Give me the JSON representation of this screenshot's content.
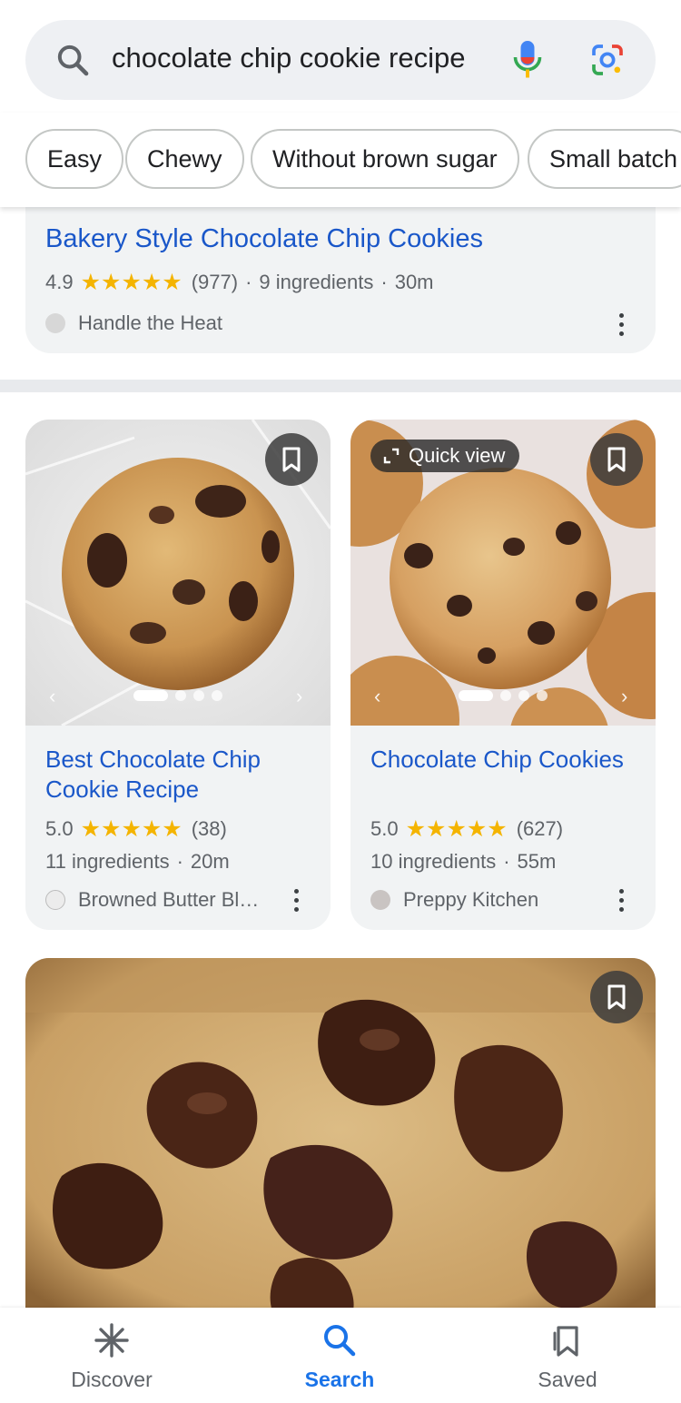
{
  "search": {
    "query": "chocolate chip cookie recipe",
    "icons": [
      "search-icon",
      "mic-icon",
      "lens-icon"
    ]
  },
  "chips": [
    "Easy",
    "Chewy",
    "Without brown sugar",
    "Small batch"
  ],
  "top_result": {
    "title": "Bakery Style Chocolate Chip Cookies",
    "rating": "4.9",
    "reviews": "(977)",
    "ingredients": "9 ingredients",
    "time": "30m",
    "source": "Handle the Heat"
  },
  "recipes": [
    {
      "title": "Best Chocolate Chip Cookie Recipe",
      "rating": "5.0",
      "reviews": "(38)",
      "ingredients": "11 ingredients",
      "time": "20m",
      "source": "Browned Butter Bl…",
      "image_slides": 4,
      "active_slide": 1
    },
    {
      "title": "Chocolate Chip Cookies",
      "rating": "5.0",
      "reviews": "(627)",
      "ingredients": "10 ingredients",
      "time": "55m",
      "source": "Preppy Kitchen",
      "quick_view_label": "Quick view",
      "image_slides": 4,
      "active_slide": 1
    }
  ],
  "nav": {
    "discover": "Discover",
    "search": "Search",
    "saved": "Saved",
    "active": "search"
  },
  "colors": {
    "link": "#1a57c9",
    "star": "#f4b400",
    "active_nav": "#1a73e8",
    "card_bg": "#f1f3f4"
  }
}
